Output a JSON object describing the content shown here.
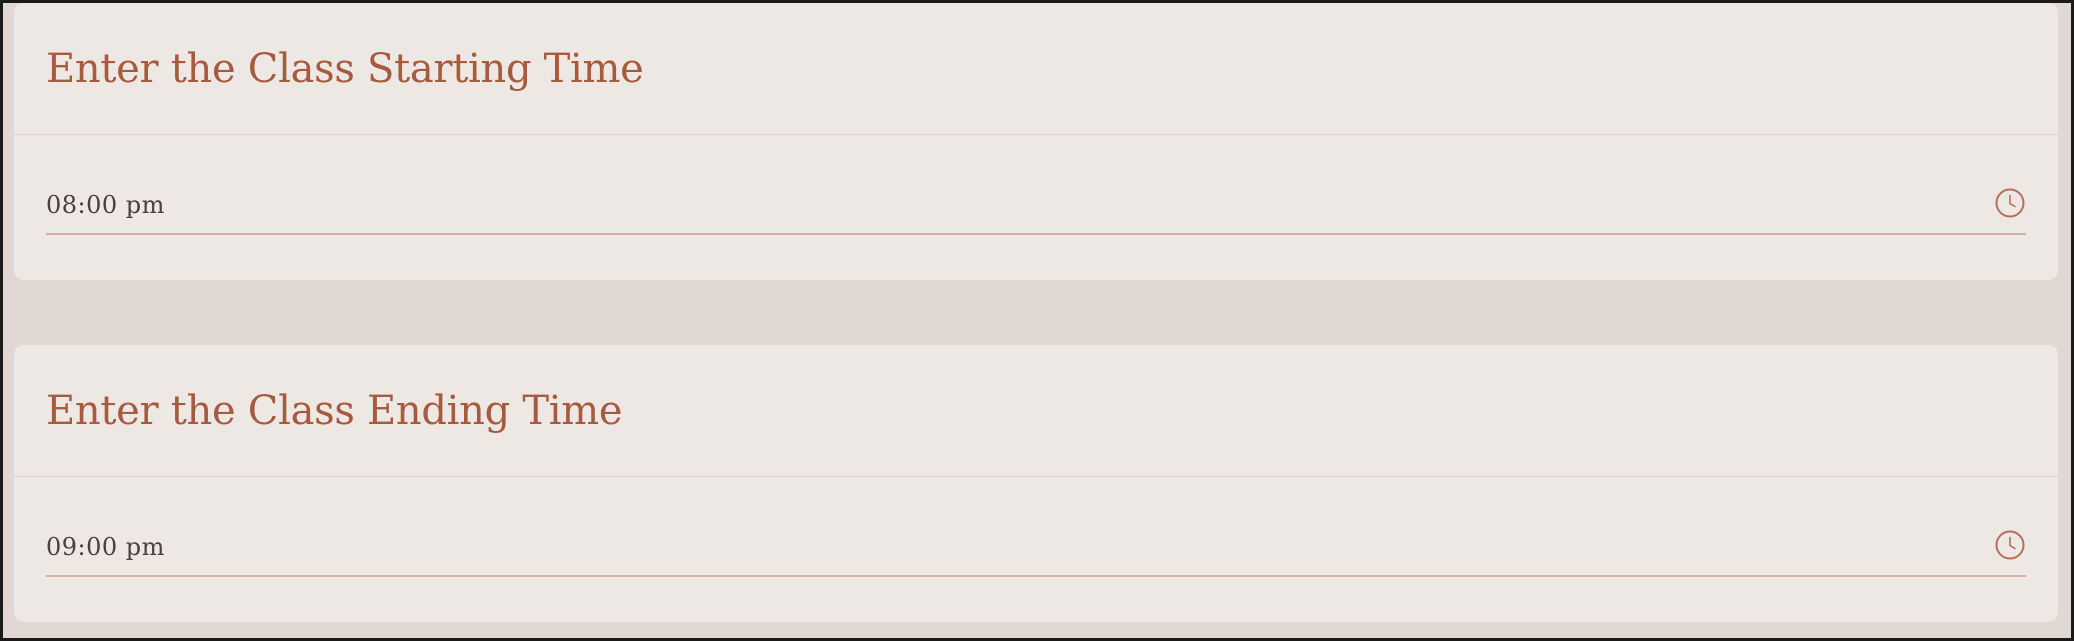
{
  "start_section": {
    "title": "Enter the Class Starting Time",
    "time_value": "08:00 pm",
    "icon": "clock-icon"
  },
  "end_section": {
    "title": "Enter the Class Ending Time",
    "time_value": "09:00 pm",
    "icon": "clock-icon"
  },
  "colors": {
    "background": "#e2d8d3",
    "card": "#ede8e4",
    "title": "#a65a3e",
    "underline": "#d8aea2",
    "text": "#4a403c"
  }
}
